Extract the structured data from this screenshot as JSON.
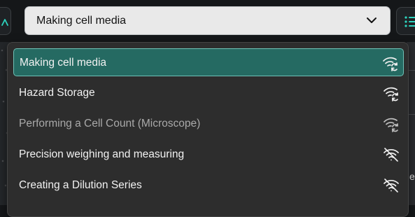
{
  "select": {
    "value": "Making cell media"
  },
  "options": [
    {
      "label": "Making cell media",
      "icon": "wifi-sync-icon",
      "selected": true,
      "muted": false
    },
    {
      "label": "Hazard Storage",
      "icon": "wifi-sync-icon",
      "selected": false,
      "muted": false
    },
    {
      "label": "Performing a Cell Count (Microscope)",
      "icon": "wifi-sync-icon",
      "selected": false,
      "muted": true
    },
    {
      "label": "Precision weighing and measuring",
      "icon": "wifi-off-icon",
      "selected": false,
      "muted": false
    },
    {
      "label": "Creating a Dilution Series",
      "icon": "wifi-off-icon",
      "selected": false,
      "muted": false
    }
  ],
  "background": {
    "right_partial_text": "el"
  },
  "colors": {
    "accent": "#2dd4bf",
    "selected_bg": "#256a62",
    "selected_border": "#6fc1b6",
    "panel_bg": "#2d2d2d",
    "select_bg": "#e9e9e9"
  }
}
